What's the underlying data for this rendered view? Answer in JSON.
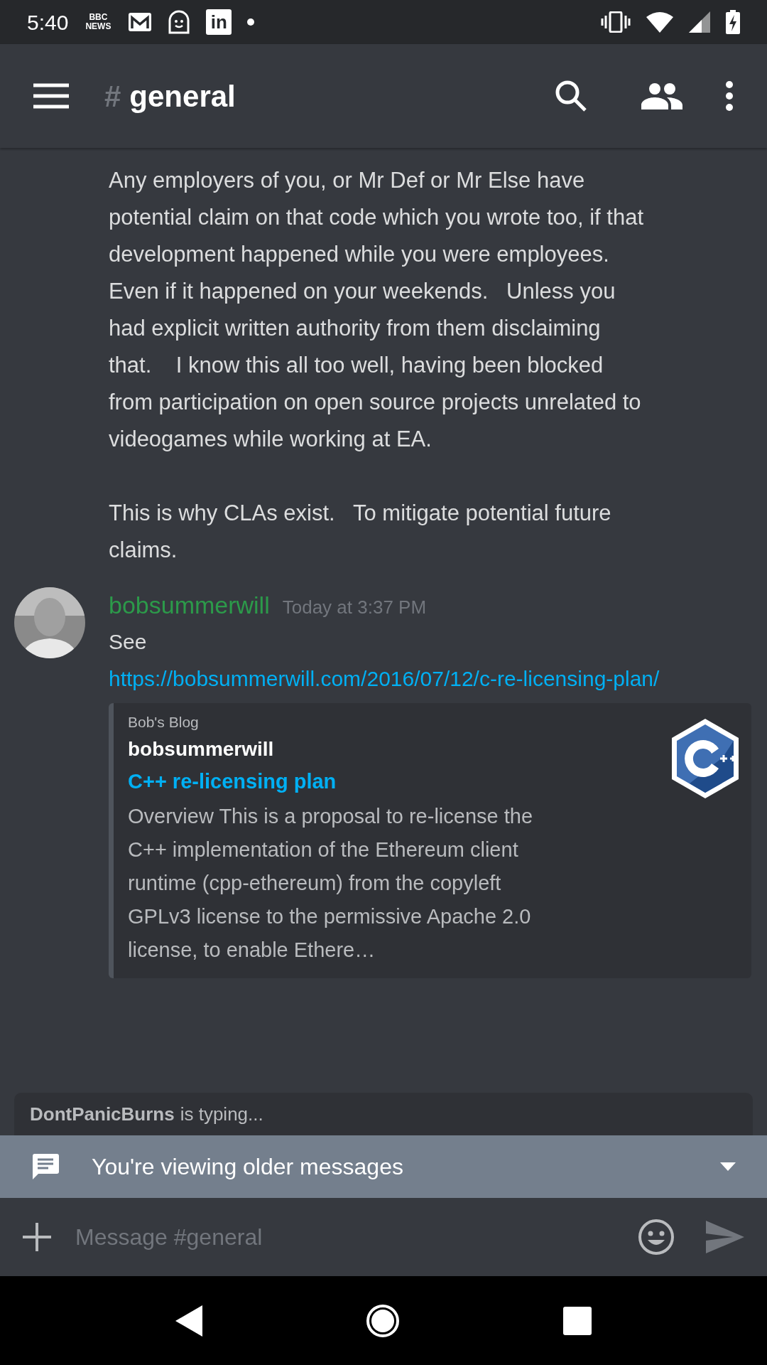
{
  "status_bar": {
    "time": "5:40",
    "notifications": [
      {
        "kind": "logo",
        "text": "BBC NEWS"
      },
      {
        "kind": "mail"
      },
      {
        "kind": "face"
      },
      {
        "kind": "tile",
        "text": "in"
      },
      {
        "kind": "dot"
      }
    ]
  },
  "header": {
    "hash": "#",
    "channel": "general"
  },
  "messages": [
    {
      "kind": "continuation",
      "paragraphs": [
        "Any employers of you, or Mr Def or Mr Else have potential claim on that code which you wrote too, if that development happened while you were employees.   Even if it happened on your weekends.   Unless you had explicit written authority from them disclaiming that.    I know this all too well, having been blocked from participation on open source projects unrelated to videogames while working at EA.",
        "This is why CLAs exist.   To mitigate potential future claims."
      ]
    },
    {
      "kind": "post",
      "author": "bobsummerwill",
      "color": "#2c9a4a",
      "timestamp": "Today at 3:37 PM",
      "text": "See",
      "link": "https://bobsummerwill.com/2016/07/12/c-re-licensing-plan/",
      "embed": {
        "provider": "Bob's Blog",
        "author": "bobsummerwill",
        "title": "C++ re-licensing plan",
        "description": "Overview This is a proposal to re-license the C++ implementation of the Ethereum client runtime (cpp-ethereum) from the copyleft GPLv3 license to the permissive Apache 2.0 license, to enable Ethere…"
      }
    }
  ],
  "typing": {
    "user": "DontPanicBurns",
    "text": "is typing..."
  },
  "older_banner": {
    "text": "You're viewing older messages"
  },
  "composer": {
    "placeholder": "Message #general"
  }
}
